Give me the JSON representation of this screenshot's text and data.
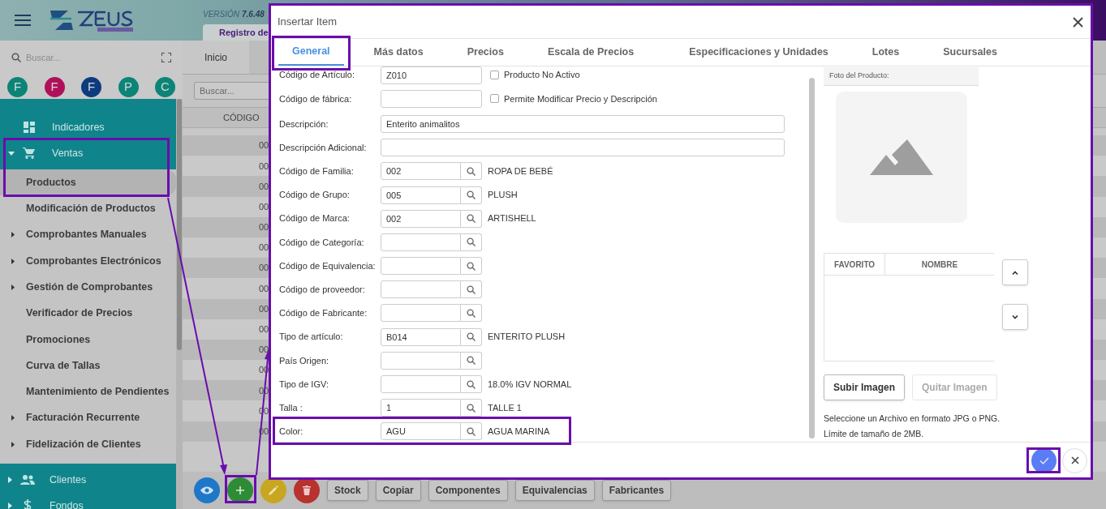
{
  "header": {
    "version_label": "VERSIÓN",
    "version_number": "7.6.48",
    "register_button": "Registro de"
  },
  "sidebar": {
    "search_placeholder": "Buscar...",
    "avatars": [
      {
        "letter": "F",
        "color": "#0c8478"
      },
      {
        "letter": "F",
        "color": "#b0105a"
      },
      {
        "letter": "F",
        "color": "#0d3c7e"
      },
      {
        "letter": "P",
        "color": "#0c8478"
      },
      {
        "letter": "C",
        "color": "#0c8478"
      }
    ],
    "top_items": [
      {
        "label": "Indicadores",
        "kind": "dashboard"
      },
      {
        "label": "Ventas",
        "kind": "cart",
        "expanded": true
      }
    ],
    "sub_items": [
      {
        "label": "Productos",
        "kind": "link",
        "selected": true
      },
      {
        "label": "Modificación de Productos",
        "kind": "link",
        "selected": false
      },
      {
        "label": "Comprobantes Manuales",
        "kind": "group",
        "selected": false
      },
      {
        "label": "Comprobantes Electrónicos",
        "kind": "group",
        "selected": false
      },
      {
        "label": "Gestión de Comprobantes",
        "kind": "group",
        "selected": false
      },
      {
        "label": "Verificador de Precios",
        "kind": "link",
        "selected": false
      },
      {
        "label": "Promociones",
        "kind": "link",
        "selected": false
      },
      {
        "label": "Curva de Tallas",
        "kind": "link",
        "selected": false
      },
      {
        "label": "Mantenimiento de Pendientes",
        "kind": "link",
        "selected": false
      },
      {
        "label": "Facturación Recurrente",
        "kind": "group",
        "selected": false
      },
      {
        "label": "Fidelización de Clientes",
        "kind": "group",
        "selected": false
      }
    ],
    "bottom_items": [
      {
        "label": "Clientes",
        "kind": "people",
        "expanded": false
      },
      {
        "label": "Fondos",
        "kind": "dollar",
        "expanded": false
      }
    ]
  },
  "main": {
    "tab": "Inicio",
    "search_placeholder": "Buscar...",
    "column": "CÓDIGO",
    "rows": [
      "00",
      "00",
      "00",
      "00",
      "00",
      "00",
      "00",
      "00",
      "00",
      "00",
      "00",
      "00",
      "00",
      "00",
      "00"
    ],
    "icon_buttons": [
      {
        "kind": "eye",
        "color": "#1f77c9"
      },
      {
        "kind": "plus",
        "color": "#2e8b36"
      },
      {
        "kind": "pencil",
        "color": "#c9a620"
      },
      {
        "kind": "trash",
        "color": "#b8322e"
      }
    ],
    "buttons": [
      "Stock",
      "Copiar",
      "Componentes",
      "Equivalencias",
      "Fabricantes"
    ]
  },
  "modal": {
    "title": "Insertar Item",
    "tabs": [
      {
        "label": "General",
        "selected": true
      },
      {
        "label": "Más datos",
        "selected": false
      },
      {
        "label": "Precios",
        "selected": false
      },
      {
        "label": "Escala de Precios",
        "selected": false
      },
      {
        "label": "Especificaciones y Unidades",
        "selected": false
      },
      {
        "label": "Lotes",
        "selected": false
      },
      {
        "label": "Sucursales",
        "selected": false
      }
    ],
    "checkboxes": [
      {
        "label": "Producto No Activo",
        "checked": false
      },
      {
        "label": "Permite Modificar Precio y Descripción",
        "checked": false
      }
    ],
    "fields": [
      {
        "label": "Código de Artículo:",
        "kind": "code",
        "value": "Z010"
      },
      {
        "label": "Código de fábrica:",
        "kind": "code"
      },
      {
        "label": "Descripción:",
        "kind": "wide",
        "value": "Enterito animalitos"
      },
      {
        "label": "Descripción Adicional:",
        "kind": "wide"
      },
      {
        "label": "Código de Familia:",
        "kind": "lookup",
        "value": "002",
        "description": "ROPA DE BEBÉ"
      },
      {
        "label": "Código de Grupo:",
        "kind": "lookup",
        "value": "005",
        "description": "PLUSH"
      },
      {
        "label": "Código de Marca:",
        "kind": "lookup",
        "value": "002",
        "description": "ARTISHELL"
      },
      {
        "label": "Código de Categoría:",
        "kind": "lookup"
      },
      {
        "label": "Código de Equivalencia:",
        "kind": "lookup"
      },
      {
        "label": "Código de proveedor:",
        "kind": "lookup"
      },
      {
        "label": "Código de Fabricante:",
        "kind": "lookup"
      },
      {
        "label": "Tipo de artículo:",
        "kind": "lookup",
        "value": "B014",
        "description": "ENTERITO PLUSH"
      },
      {
        "label": "País Origen:",
        "kind": "lookup"
      },
      {
        "label": "Tipo de IGV:",
        "kind": "lookup",
        "description": "18.0% IGV NORMAL"
      },
      {
        "label": "Talla :",
        "kind": "lookup",
        "value": "1",
        "description": "TALLE 1"
      },
      {
        "label": "Color:",
        "kind": "lookup",
        "value": "AGU",
        "description": "AGUA MARINA"
      }
    ],
    "photo_title": "Foto del Producto:",
    "photo_columns": [
      "FAVORITO",
      "NOMBRE"
    ],
    "photo_buttons": [
      {
        "label": "Subir Imagen",
        "disabled": false
      },
      {
        "label": "Quitar Imagen",
        "disabled": true
      }
    ],
    "notes": [
      "Seleccione un Archivo en formato JPG o PNG.",
      "Límite de tamaño de 2MB."
    ]
  }
}
